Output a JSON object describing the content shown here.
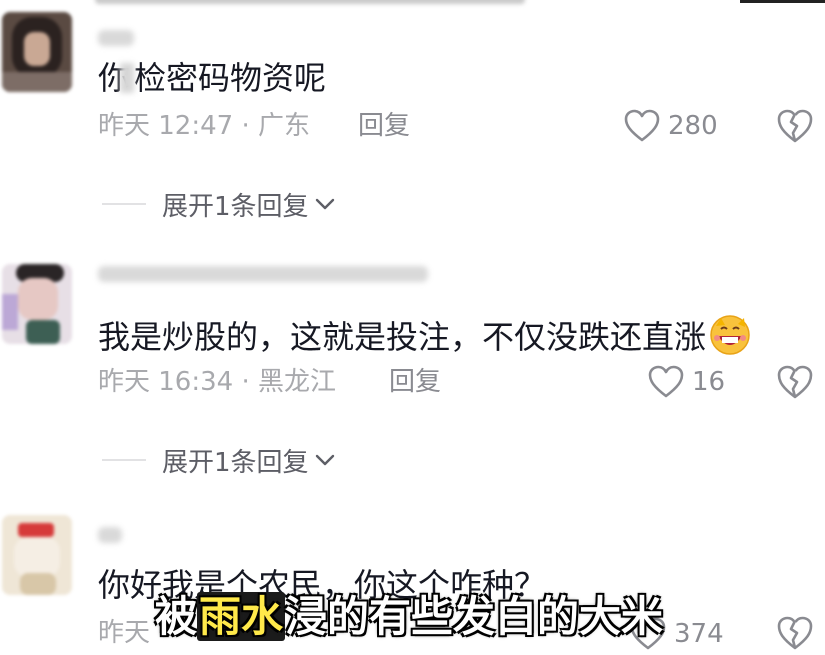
{
  "comments": [
    {
      "content": "你猜检密码物资呢",
      "content_prefix": "你",
      "content_rest": "检密码物资呢",
      "meta": "昨天 12:47 · 广东",
      "reply_label": "回复",
      "likes": "280",
      "expand_label": "展开1条回复"
    },
    {
      "content": "我是炒股的，这就是投注，不仅没跌还直涨",
      "meta": "昨天 16:34 · 黑龙江",
      "reply_label": "回复",
      "likes": "16",
      "emoji": "grinning-face-with-money-icon",
      "expand_label": "展开1条回复"
    },
    {
      "content": "你好我是个农民，你这个咋种？",
      "meta": "昨天",
      "reply_label": "回复",
      "likes": "374"
    }
  ],
  "caption": {
    "part1": "被",
    "highlight": "雨水",
    "part2": "浸的有些发白的大米"
  },
  "colors": {
    "text": "#161823",
    "meta": "#a8a9ad",
    "icon": "#8a8b91",
    "caption_highlight": "#ffe94a"
  },
  "icons": [
    "heart-outline-icon",
    "broken-heart-icon",
    "chevron-down-icon"
  ]
}
